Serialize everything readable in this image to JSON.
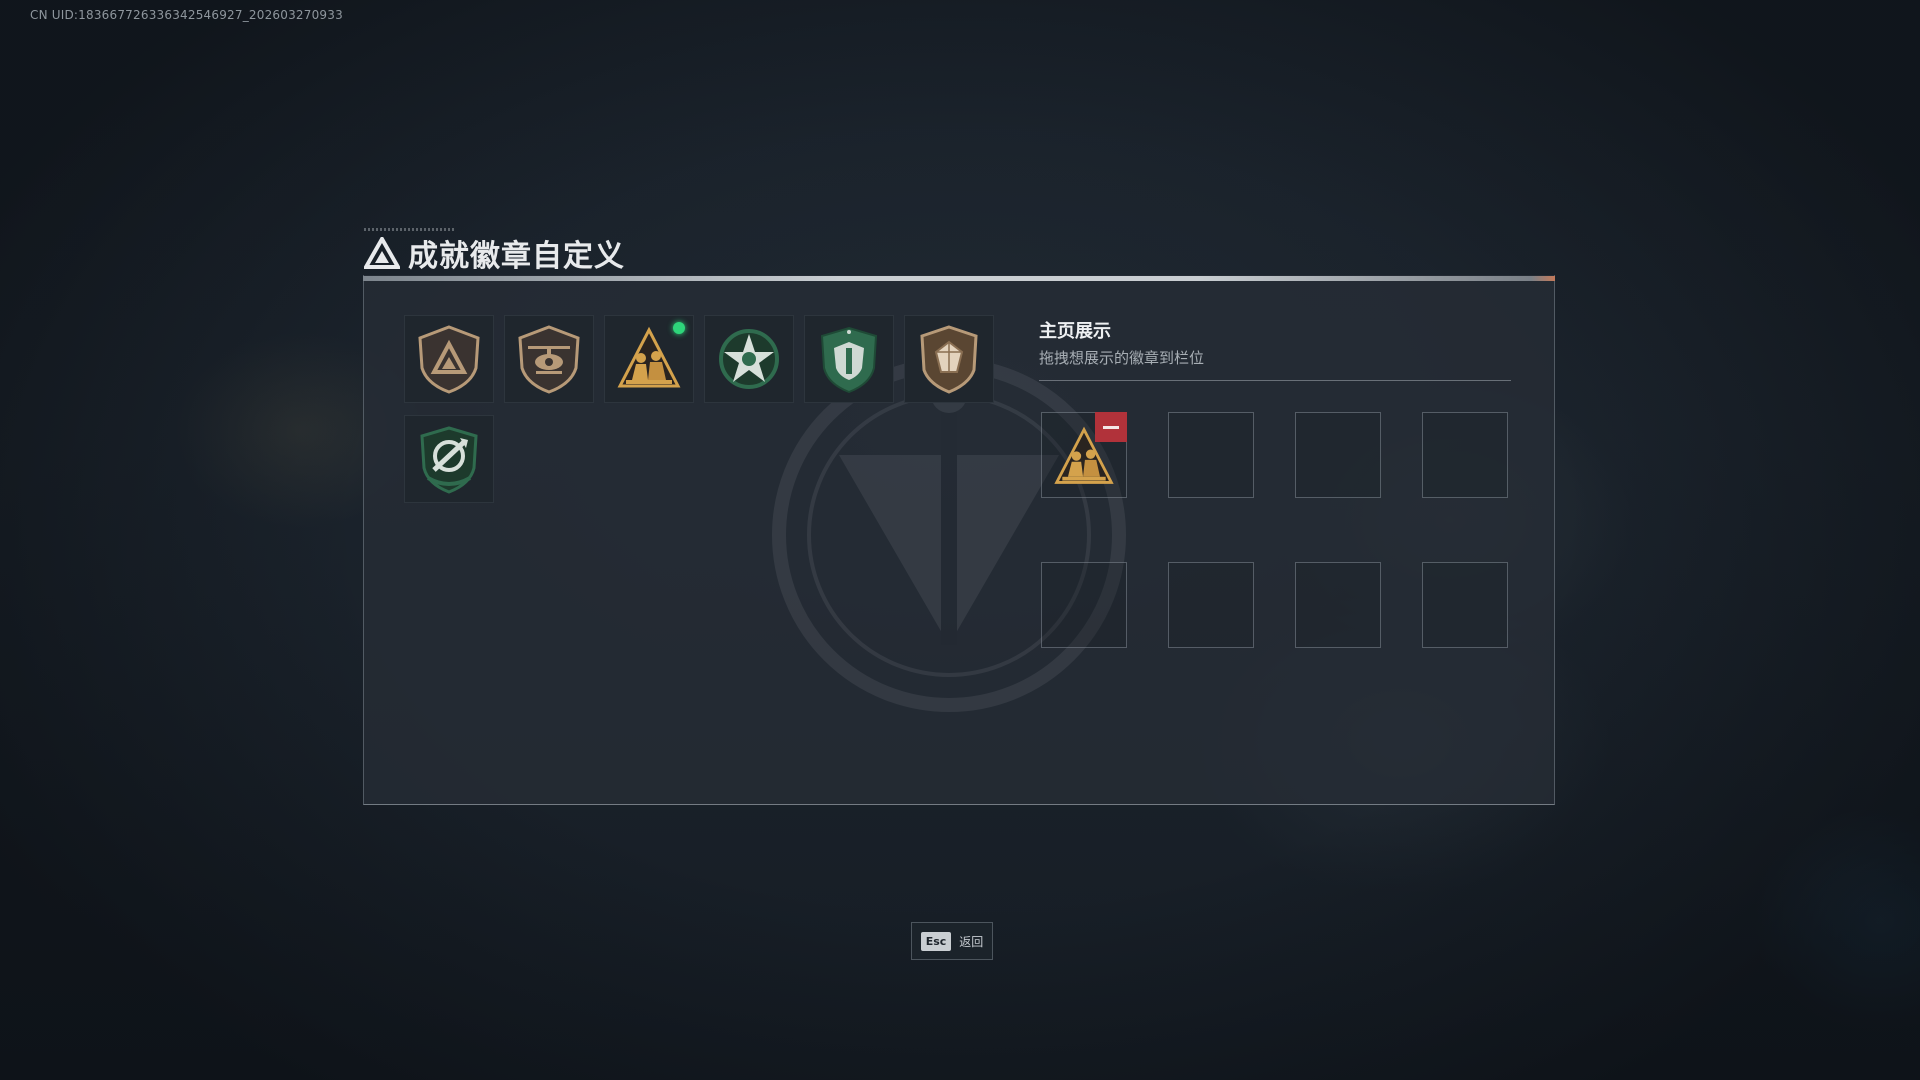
{
  "uid_text": "CN UID:183667726336342546927_202603270933",
  "title": "成就徽章自定义",
  "inventory": {
    "badges": [
      {
        "name": "delta-shield-badge-icon",
        "style": "bronze",
        "new": false
      },
      {
        "name": "helicopter-badge-icon",
        "style": "bronze",
        "new": false
      },
      {
        "name": "squad-triangle-badge-icon",
        "style": "gold",
        "new": true
      },
      {
        "name": "green-star-badge-icon",
        "style": "green",
        "new": false
      },
      {
        "name": "green-shield-badge-icon",
        "style": "green",
        "new": false
      },
      {
        "name": "gem-shield-badge-icon",
        "style": "bronze",
        "new": false
      },
      {
        "name": "green-arrows-badge-icon",
        "style": "green",
        "new": false
      }
    ]
  },
  "showcase": {
    "title": "主页展示",
    "subtitle": "拖拽想展示的徽章到栏位",
    "slots_total": 8,
    "filled": [
      {
        "slot": 1,
        "badge": "squad-triangle-badge-icon"
      }
    ]
  },
  "footer": {
    "esc_key": "Esc",
    "esc_label": "返回"
  },
  "colors": {
    "accent_green": "#2ed57a",
    "remove_red": "#b1323a",
    "bronze": "#b79a78",
    "gold": "#d4a24c",
    "green": "#2f6b4e"
  }
}
